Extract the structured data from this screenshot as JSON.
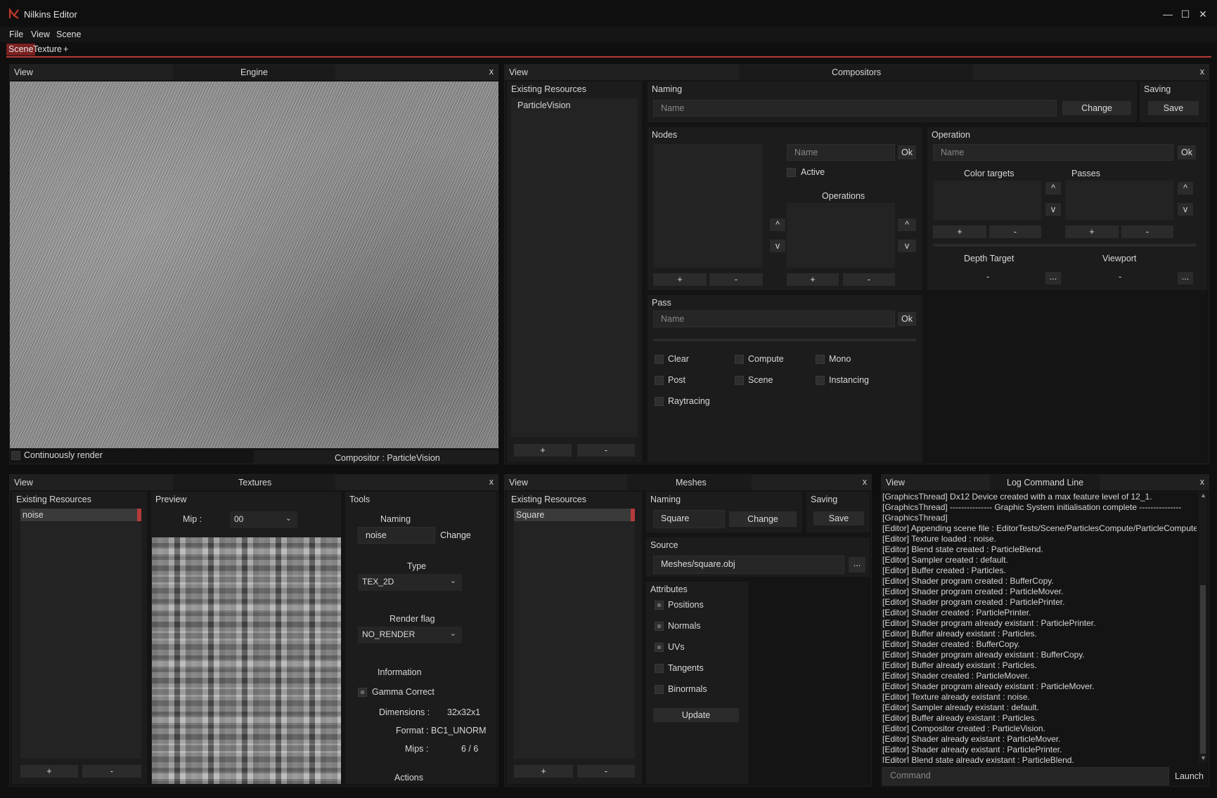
{
  "window": {
    "title": "Nilkins Editor",
    "minimize_glyph": "—",
    "maximize_glyph": "☐",
    "close_glyph": "✕"
  },
  "menu": [
    "File",
    "View",
    "Scene"
  ],
  "tabs": {
    "scene": "Scene",
    "texture": "Texture",
    "add": "+"
  },
  "common": {
    "view": "View",
    "close": "x",
    "plus": "+",
    "minus": "-",
    "up": "^",
    "down": "v",
    "ok": "Ok",
    "ellipsis": "...",
    "dash": "-"
  },
  "engine": {
    "title": "Engine",
    "continuously_render": "Continuously render",
    "compositor_label": "Compositor : ParticleVision"
  },
  "compositors": {
    "title": "Compositors",
    "existing_resources": "Existing Resources",
    "resources": [
      "ParticleVision"
    ],
    "naming": "Naming",
    "name_placeholder": "Name",
    "change": "Change",
    "saving": "Saving",
    "save": "Save",
    "nodes": "Nodes",
    "active": "Active",
    "operations": "Operations",
    "operation": "Operation",
    "color_targets": "Color targets",
    "passes": "Passes",
    "depth_target": "Depth Target",
    "viewport": "Viewport",
    "pass": "Pass",
    "pass_flags": [
      "Clear",
      "Compute",
      "Mono",
      "Post",
      "Scene",
      "Instancing",
      "Raytracing"
    ]
  },
  "textures": {
    "title": "Textures",
    "existing_resources": "Existing Resources",
    "resources": [
      "noise"
    ],
    "preview": "Preview",
    "mip_label": "Mip :",
    "mip_value": "00",
    "tools": "Tools",
    "naming": "Naming",
    "name_value": "noise",
    "change": "Change",
    "type_label": "Type",
    "type_value": "TEX_2D",
    "render_flag_label": "Render flag",
    "render_flag_value": "NO_RENDER",
    "information": "Information",
    "gamma_correct": "Gamma Correct",
    "dimensions_label": "Dimensions :",
    "dimensions_value": "32x32x1",
    "format": "Format : BC1_UNORM",
    "mips_label": "Mips :",
    "mips_value": "6 / 6",
    "actions": "Actions"
  },
  "meshes": {
    "title": "Meshes",
    "existing_resources": "Existing Resources",
    "resources": [
      "Square"
    ],
    "naming": "Naming",
    "name_value": "Square",
    "change": "Change",
    "saving": "Saving",
    "save": "Save",
    "source": "Source",
    "source_value": "Meshes/square.obj",
    "attributes": "Attributes",
    "attribute_list": [
      "Positions",
      "Normals",
      "UVs",
      "Tangents",
      "Binormals"
    ],
    "update": "Update"
  },
  "log": {
    "title": "Log Command Line",
    "lines": [
      "[GraphicsThread] Dx12 Device created with a max feature level of 12_1.",
      "[GraphicsThread] --------------- Graphic System initialisation complete ---------------",
      "[GraphicsThread]",
      "[Editor] Appending scene file : EditorTests/Scene/ParticlesCompute/ParticleCompute",
      "[Editor] Texture loaded : noise.",
      "[Editor] Blend state created : ParticleBlend.",
      "[Editor] Sampler created : default.",
      "[Editor] Buffer created : Particles.",
      "[Editor] Shader program created : BufferCopy.",
      "[Editor] Shader program created : ParticleMover.",
      "[Editor] Shader program created : ParticlePrinter.",
      "[Editor] Shader created : ParticlePrinter.",
      "[Editor] Shader program already existant : ParticlePrinter.",
      "[Editor] Buffer already existant : Particles.",
      "[Editor] Shader created : BufferCopy.",
      "[Editor] Shader program already existant : BufferCopy.",
      "[Editor] Buffer already existant : Particles.",
      "[Editor] Shader created : ParticleMover.",
      "[Editor] Shader program already existant : ParticleMover.",
      "[Editor] Texture already existant : noise.",
      "[Editor] Sampler already existant : default.",
      "[Editor] Buffer already existant : Particles.",
      "[Editor] Compositor created : ParticleVision.",
      "[Editor] Shader already existant : ParticleMover.",
      "[Editor] Shader already existant : ParticlePrinter.",
      "[Editor] Blend state already existant : ParticleBlend."
    ],
    "command_placeholder": "Command",
    "launch": "Launch"
  }
}
